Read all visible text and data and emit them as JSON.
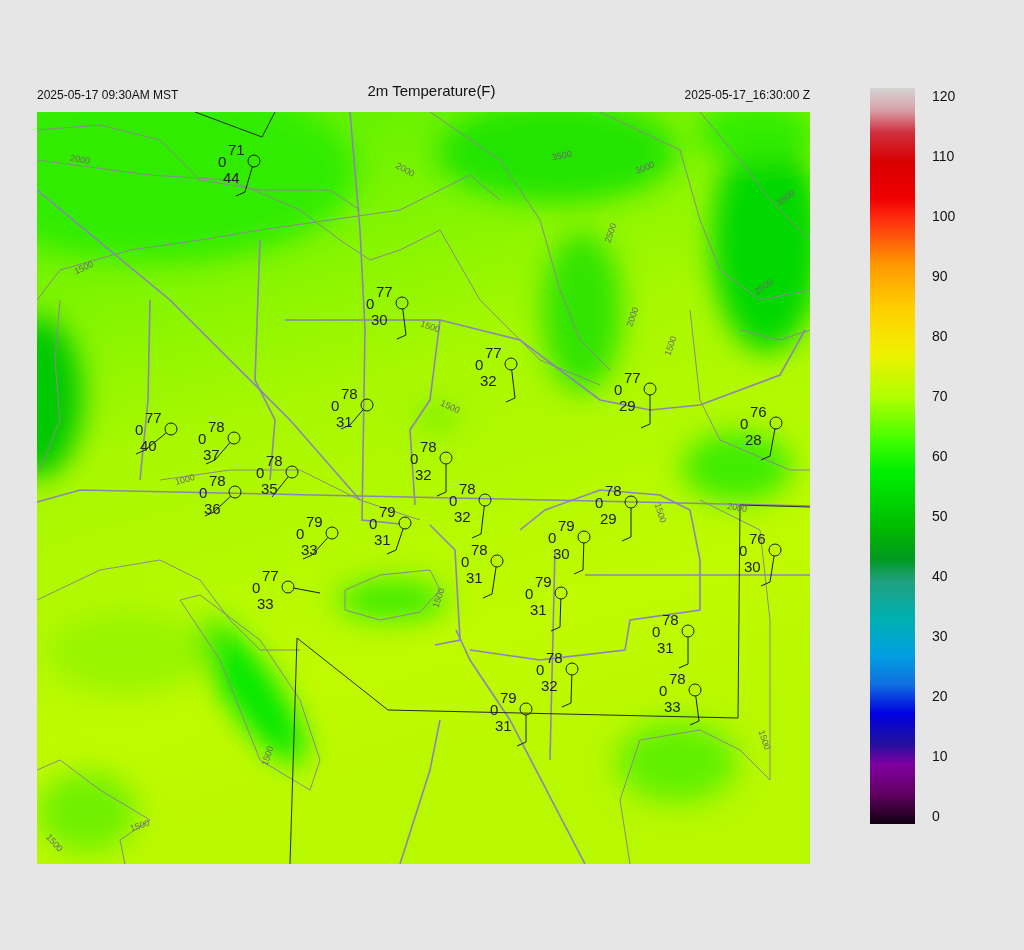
{
  "header": {
    "left": "2025-05-17 09:30AM MST",
    "title": "2m Temperature(F)",
    "right": "2025-05-17_16:30:00 Z"
  },
  "map": {
    "stations": [
      {
        "temperature": "71",
        "left_value": "0",
        "dewpoint": "44"
      },
      {
        "temperature": "77",
        "left_value": "0",
        "dewpoint": "30"
      },
      {
        "temperature": "77",
        "left_value": "0",
        "dewpoint": "32"
      },
      {
        "temperature": "77",
        "left_value": "0",
        "dewpoint": "29"
      },
      {
        "temperature": "76",
        "left_value": "0",
        "dewpoint": "28"
      },
      {
        "temperature": "78",
        "left_value": "0",
        "dewpoint": "31"
      },
      {
        "temperature": "77",
        "left_value": "0",
        "dewpoint": "40"
      },
      {
        "temperature": "78",
        "left_value": "0",
        "dewpoint": "37"
      },
      {
        "temperature": "78",
        "left_value": "0",
        "dewpoint": "35"
      },
      {
        "temperature": "78",
        "left_value": "0",
        "dewpoint": "32"
      },
      {
        "temperature": "78",
        "left_value": "0",
        "dewpoint": "36"
      },
      {
        "temperature": "78",
        "left_value": "0",
        "dewpoint": "32"
      },
      {
        "temperature": "78",
        "left_value": "0",
        "dewpoint": "29"
      },
      {
        "temperature": "79",
        "left_value": "0",
        "dewpoint": "31"
      },
      {
        "temperature": "79",
        "left_value": "0",
        "dewpoint": "33"
      },
      {
        "temperature": "79",
        "left_value": "0",
        "dewpoint": "30"
      },
      {
        "temperature": "76",
        "left_value": "0",
        "dewpoint": "30"
      },
      {
        "temperature": "78",
        "left_value": "0",
        "dewpoint": "31"
      },
      {
        "temperature": "77",
        "left_value": "0",
        "dewpoint": "33"
      },
      {
        "temperature": "79",
        "left_value": "0",
        "dewpoint": "31"
      },
      {
        "temperature": "78",
        "left_value": "0",
        "dewpoint": "31"
      },
      {
        "temperature": "78",
        "left_value": "0",
        "dewpoint": "32"
      },
      {
        "temperature": "78",
        "left_value": "0",
        "dewpoint": "33"
      },
      {
        "temperature": "79",
        "left_value": "0",
        "dewpoint": "31"
      }
    ],
    "contour_labels": [
      "2000",
      "2000",
      "3500",
      "3000",
      "3500",
      "2500",
      "2500",
      "2000",
      "1500",
      "1500",
      "1500",
      "1500",
      "1000",
      "1500",
      "2000",
      "1500",
      "1500",
      "1500",
      "1500",
      "1500"
    ]
  },
  "colorbar": {
    "labels": [
      "120",
      "110",
      "100",
      "90",
      "80",
      "70",
      "60",
      "50",
      "40",
      "30",
      "20",
      "10",
      "0"
    ]
  }
}
